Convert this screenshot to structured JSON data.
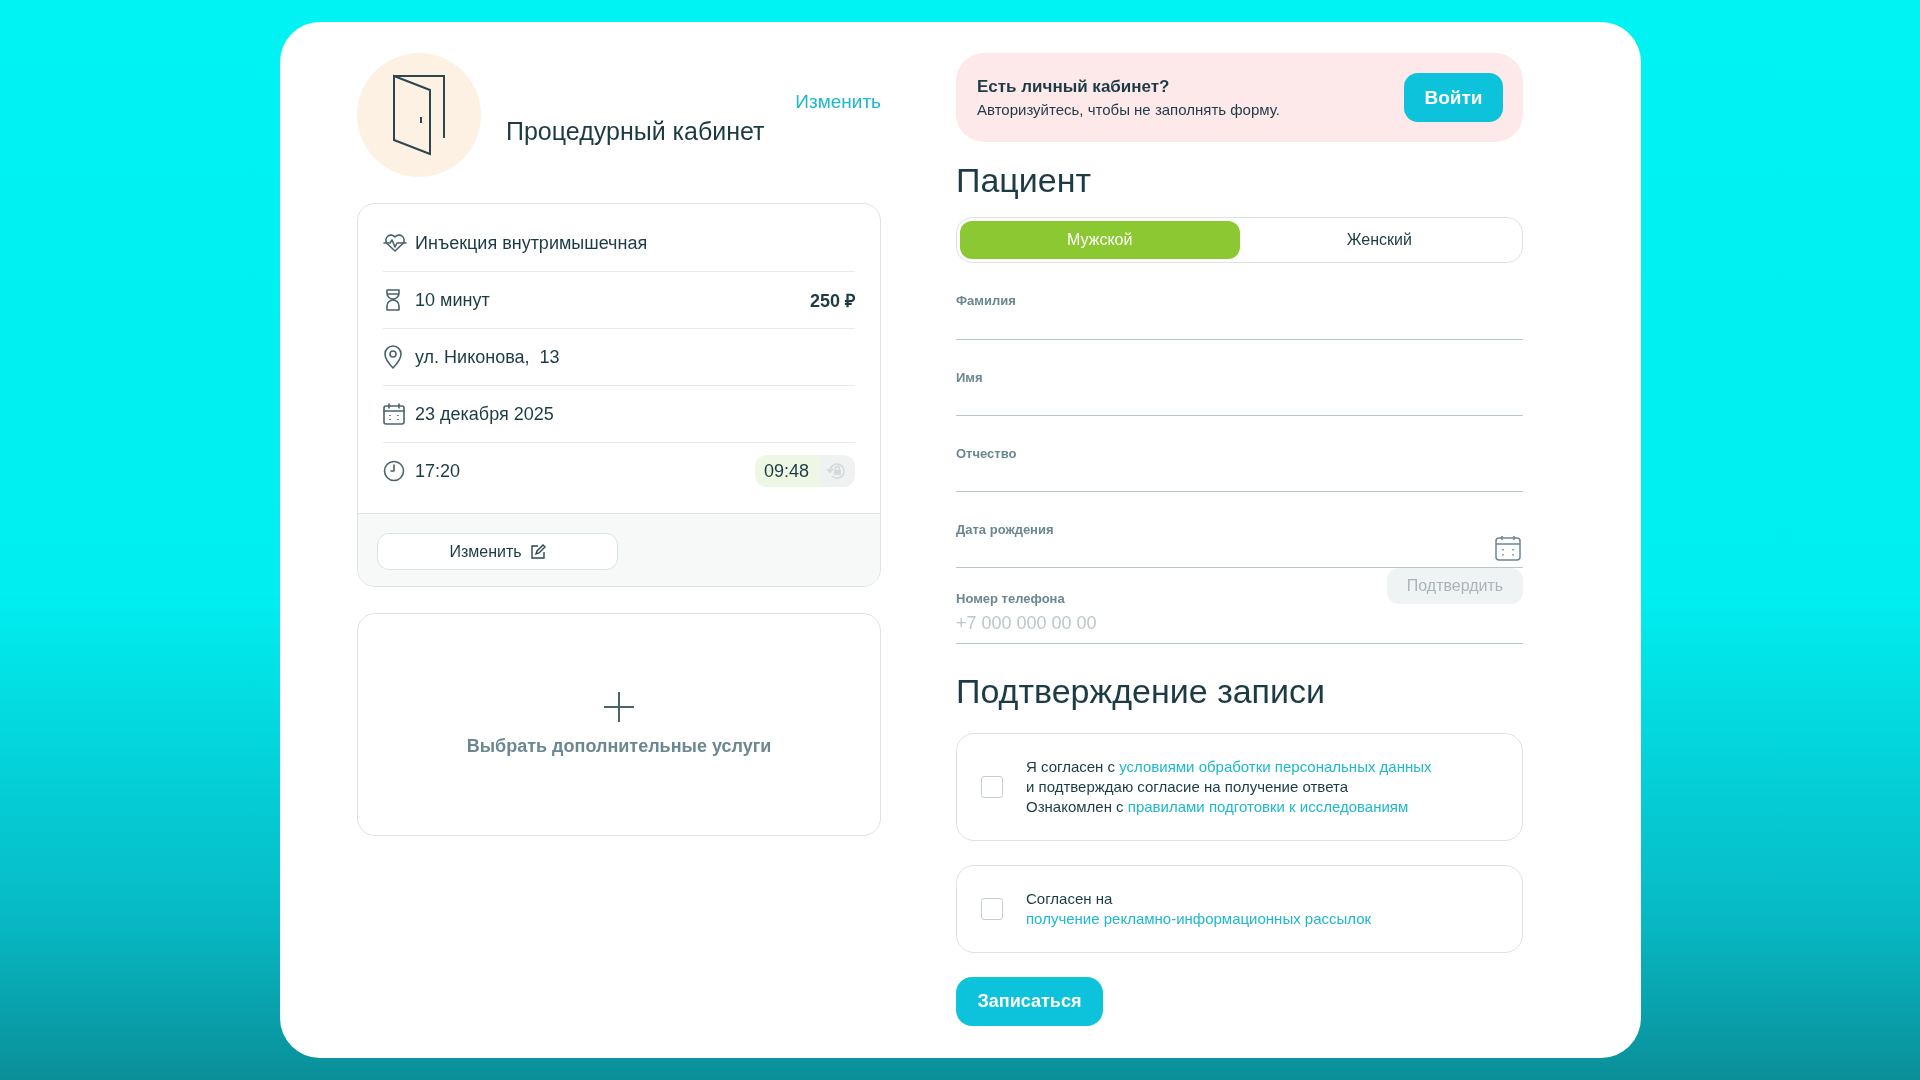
{
  "room": {
    "title": "Процедурный кабинет",
    "change_link": "Изменить"
  },
  "details": [
    {
      "kind": "service",
      "text": "Инъекция внутримышечная"
    },
    {
      "kind": "duration",
      "text": "10 минут",
      "price": "250 ₽"
    },
    {
      "kind": "address",
      "text": "ул. Никонова,  13"
    },
    {
      "kind": "date",
      "text": "23 декабря 2025"
    },
    {
      "kind": "time",
      "text": "17:20",
      "timer": "09:48"
    }
  ],
  "details_button": "Изменить",
  "extra_services": {
    "label": "Выбрать дополнительные услуги"
  },
  "login_banner": {
    "title": "Есть личный кабинет?",
    "text": "Авторизуйтесь, чтобы не заполнять форму.",
    "button": "Войти"
  },
  "patient": {
    "heading": "Пациент",
    "gender_tabs": [
      {
        "label": "Мужской",
        "selected": true
      },
      {
        "label": "Женский",
        "selected": false
      }
    ],
    "fields": [
      {
        "kind": "text",
        "label": "Фамилия"
      },
      {
        "kind": "text",
        "label": "Имя"
      },
      {
        "kind": "text",
        "label": "Отчество"
      },
      {
        "kind": "date",
        "label": "Дата рождения"
      },
      {
        "kind": "phone",
        "label": "Номер телефона",
        "placeholder": "+7 000 000 00 00",
        "button": "Подтвердить"
      }
    ]
  },
  "confirmation": {
    "heading": "Подтверждение записи",
    "consents": [
      {
        "checked": false,
        "lines": [
          [
            {
              "kind": "text",
              "text": "Я согласен с "
            },
            {
              "kind": "link",
              "text": "условиями обработки персональных данных"
            }
          ],
          [
            {
              "kind": "text",
              "text": "и подтверждаю согласие на получение ответа"
            }
          ],
          [
            {
              "kind": "text",
              "text": "Ознакомлен с "
            },
            {
              "kind": "link",
              "text": "правилами подготовки к исследованиям"
            }
          ]
        ]
      },
      {
        "checked": false,
        "lines": [
          [
            {
              "kind": "text",
              "text": "Согласен на"
            }
          ],
          [
            {
              "kind": "link",
              "text": "получение рекламно-информационных рассылок"
            }
          ]
        ]
      }
    ],
    "submit": "Записаться"
  }
}
